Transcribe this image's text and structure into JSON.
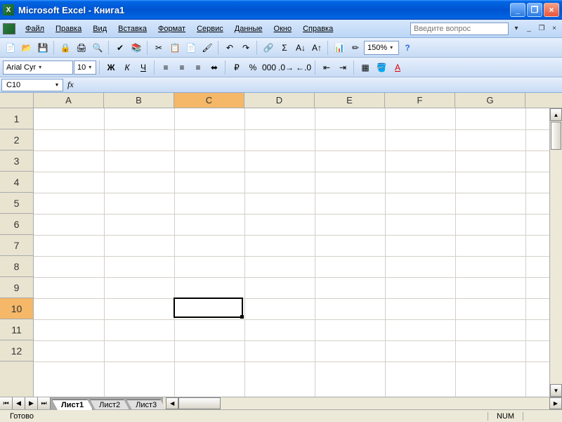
{
  "titlebar": {
    "title": "Microsoft Excel - Книга1"
  },
  "menu": {
    "file": "Файл",
    "edit": "Правка",
    "view": "Вид",
    "insert": "Вставка",
    "format": "Формат",
    "tools": "Сервис",
    "data": "Данные",
    "window": "Окно",
    "help": "Справка",
    "question_placeholder": "Введите вопрос"
  },
  "toolbar1": {
    "zoom": "150%"
  },
  "toolbar2": {
    "font_name": "Arial Cyr",
    "font_size": "10",
    "bold": "Ж",
    "italic": "К",
    "underline": "Ч"
  },
  "formulabar": {
    "namebox": "C10",
    "fx": "fx",
    "formula": ""
  },
  "grid": {
    "columns": [
      "A",
      "B",
      "C",
      "D",
      "E",
      "F",
      "G"
    ],
    "rows": [
      "1",
      "2",
      "3",
      "4",
      "5",
      "6",
      "7",
      "8",
      "9",
      "10",
      "11",
      "12"
    ],
    "selected_col_index": 2,
    "selected_row_index": 9
  },
  "sheets": {
    "tabs": [
      "Лист1",
      "Лист2",
      "Лист3"
    ],
    "active": 0
  },
  "status": {
    "ready": "Готово",
    "num": "NUM"
  }
}
